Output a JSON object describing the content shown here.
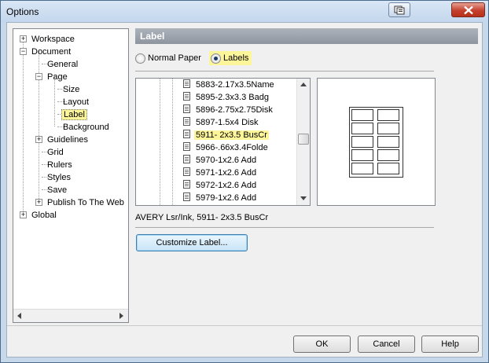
{
  "window": {
    "title": "Options"
  },
  "tree": {
    "items": [
      {
        "label": "Workspace",
        "expander": "+",
        "indent": 0
      },
      {
        "label": "Document",
        "expander": "−",
        "indent": 0
      },
      {
        "label": "General",
        "indent": 1
      },
      {
        "label": "Page",
        "expander": "−",
        "indent": 1
      },
      {
        "label": "Size",
        "indent": 2
      },
      {
        "label": "Layout",
        "indent": 2
      },
      {
        "label": "Label",
        "indent": 2,
        "selected": true
      },
      {
        "label": "Background",
        "indent": 2
      },
      {
        "label": "Guidelines",
        "expander": "+",
        "indent": 1
      },
      {
        "label": "Grid",
        "indent": 1
      },
      {
        "label": "Rulers",
        "indent": 1
      },
      {
        "label": "Styles",
        "indent": 1
      },
      {
        "label": "Save",
        "indent": 1
      },
      {
        "label": "Publish To The Web",
        "expander": "+",
        "indent": 1
      },
      {
        "label": "Global",
        "expander": "+",
        "indent": 0
      }
    ]
  },
  "panel": {
    "header": "Label",
    "normal_paper_label": "Normal Paper",
    "labels_label": "Labels",
    "selected_radio": "labels",
    "label_list": [
      {
        "text": "5883-2.17x3.5Name"
      },
      {
        "text": "5895-2.3x3.3 Badg"
      },
      {
        "text": "5896-2.75x2.75Disk"
      },
      {
        "text": "5897-1.5x4 Disk"
      },
      {
        "text": "5911- 2x3.5 BusCr",
        "selected": true
      },
      {
        "text": "5966-.66x3.4Folde"
      },
      {
        "text": "5970-1x2.6 Add"
      },
      {
        "text": "5971-1x2.6 Add"
      },
      {
        "text": "5972-1x2.6 Add"
      },
      {
        "text": "5979-1x2.6 Add"
      }
    ],
    "description": "AVERY Lsr/Ink, 5911- 2x3.5 BusCr",
    "customize_button": "Customize Label..."
  },
  "footer": {
    "ok": "OK",
    "cancel": "Cancel",
    "help": "Help"
  },
  "icons": {
    "titlebar_help": "context-help-icon",
    "titlebar_close": "close-icon",
    "list_item": "document-icon"
  },
  "colors": {
    "highlight": "#fdf59a",
    "header_bg": "#9aa1aa",
    "window_frame": "#c7d8eb"
  }
}
